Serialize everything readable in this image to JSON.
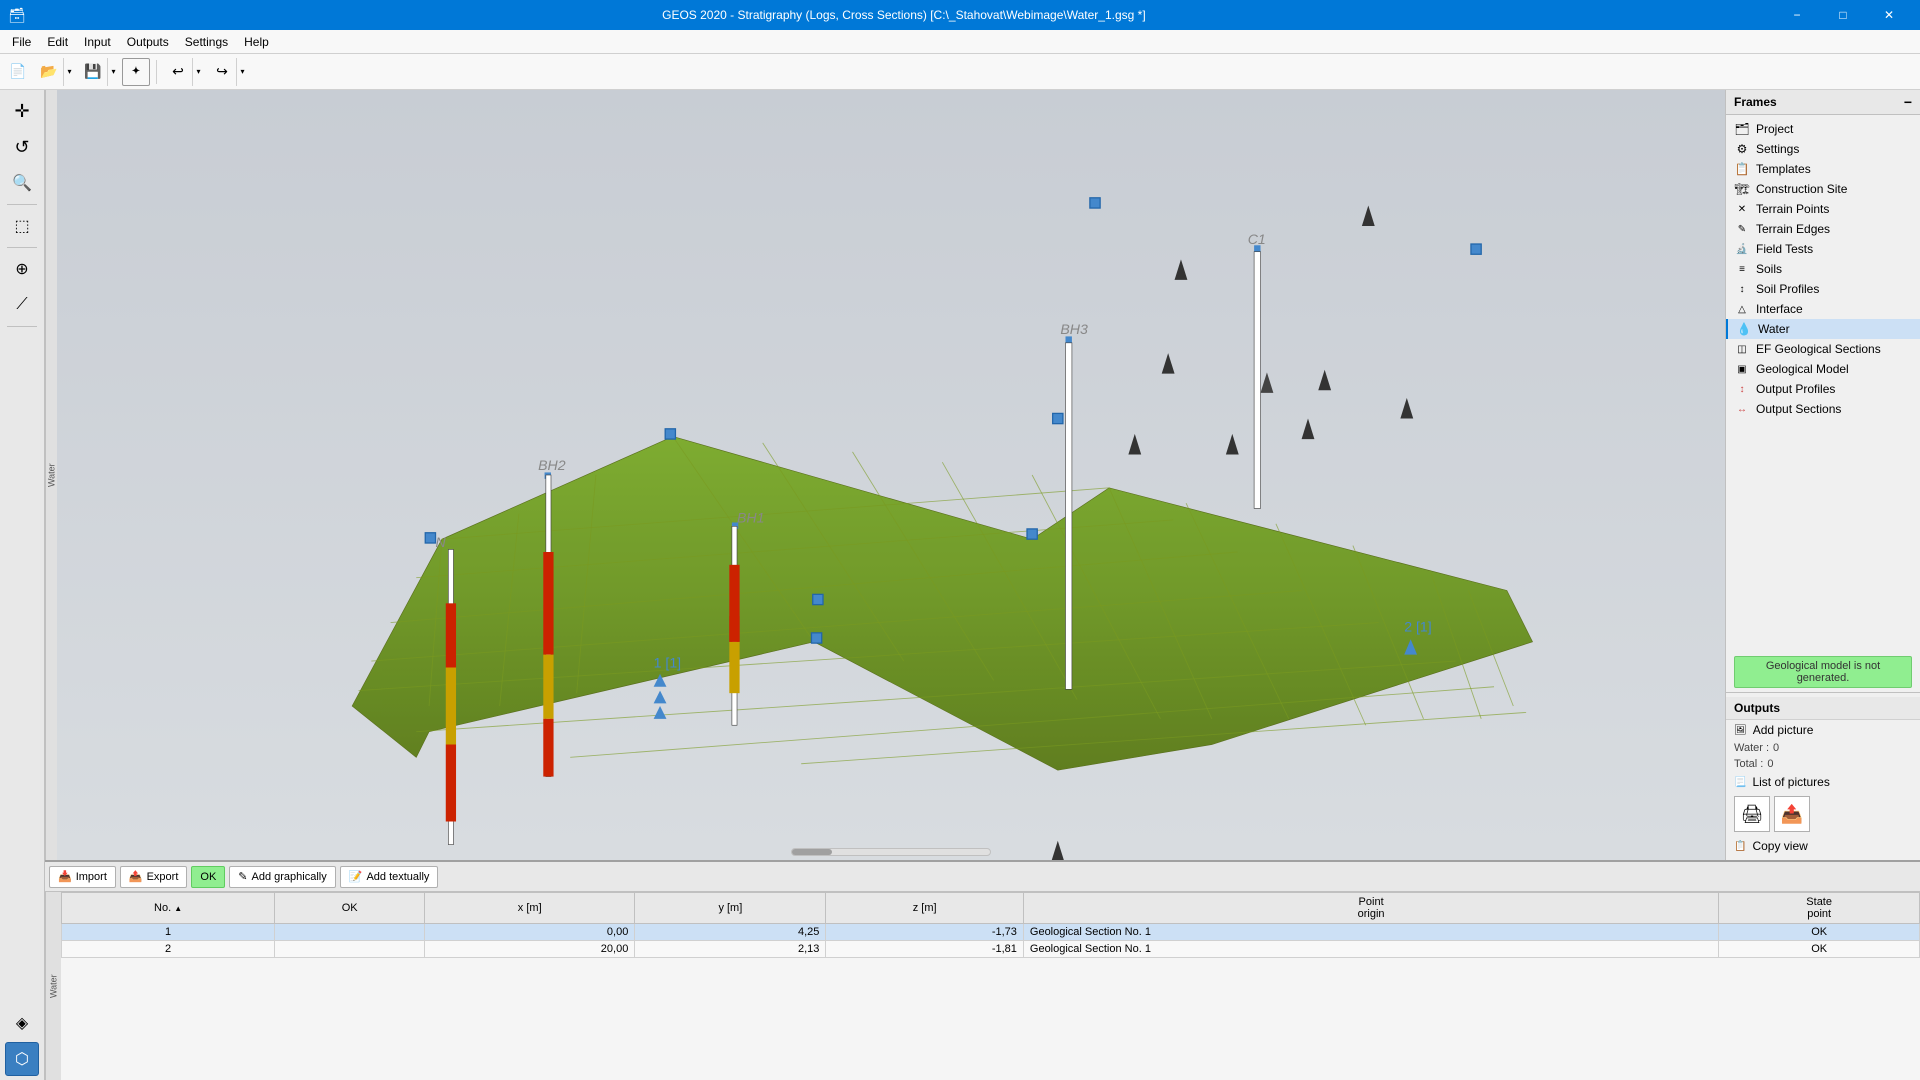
{
  "window": {
    "title": "GEOS 2020 - Stratigraphy (Logs, Cross Sections) [C:\\_Stahovat\\Webimage\\Water_1.gsg *]",
    "icon": "🗃"
  },
  "menu": {
    "items": [
      "File",
      "Edit",
      "Input",
      "Outputs",
      "Settings",
      "Help"
    ]
  },
  "toolbar": {
    "new_label": "📄",
    "open_label": "📂",
    "save_label": "💾",
    "undo_label": "↩",
    "redo_label": "↪"
  },
  "tools": {
    "items": [
      {
        "name": "move",
        "icon": "✛",
        "title": "Move"
      },
      {
        "name": "rotate",
        "icon": "↺",
        "title": "Rotate"
      },
      {
        "name": "zoom",
        "icon": "🔍",
        "title": "Zoom"
      },
      {
        "name": "select-region",
        "icon": "⬚",
        "title": "Select Region"
      },
      {
        "name": "add-point",
        "icon": "⊕",
        "title": "Add Point"
      },
      {
        "name": "add-line",
        "icon": "⟋",
        "title": "Add Line"
      },
      {
        "name": "view-3d",
        "icon": "◈",
        "title": "3D View"
      },
      {
        "name": "view-solid",
        "icon": "⬡",
        "title": "Solid View"
      }
    ]
  },
  "frames": {
    "header": "Frames",
    "items": [
      {
        "id": "project",
        "label": "Project",
        "icon": "🗂"
      },
      {
        "id": "settings",
        "label": "Settings",
        "icon": "⚙"
      },
      {
        "id": "templates",
        "label": "Templates",
        "icon": "📋"
      },
      {
        "id": "construction-site",
        "label": "Construction Site",
        "icon": "🏗"
      },
      {
        "id": "terrain-points",
        "label": "Terrain Points",
        "icon": "✕"
      },
      {
        "id": "terrain-edges",
        "label": "Terrain Edges",
        "icon": "✎"
      },
      {
        "id": "field-tests",
        "label": "Field Tests",
        "icon": "🔬"
      },
      {
        "id": "soils",
        "label": "Soils",
        "icon": "≡"
      },
      {
        "id": "soil-profiles",
        "label": "Soil Profiles",
        "icon": "↕"
      },
      {
        "id": "interface",
        "label": "Interface",
        "icon": "△"
      },
      {
        "id": "water",
        "label": "Water",
        "icon": "💧",
        "active": true
      },
      {
        "id": "geological-sections",
        "label": "Geological Sections",
        "icon": "◫"
      },
      {
        "id": "geological-model",
        "label": "Geological Model",
        "icon": "▣"
      },
      {
        "id": "output-profiles",
        "label": "Output Profiles",
        "icon": "↕"
      },
      {
        "id": "output-sections",
        "label": "Output Sections",
        "icon": "↔"
      }
    ]
  },
  "geo_model_badge": "Geological model is\nnot generated.",
  "outputs": {
    "header": "Outputs",
    "add_picture": "Add picture",
    "water_label": "Water :",
    "water_value": "0",
    "total_label": "Total :",
    "total_value": "0",
    "list_of_pictures": "List of pictures",
    "copy_view": "Copy view"
  },
  "bottom_toolbar": {
    "import": "Import",
    "export": "Export",
    "ok_label": "OK",
    "add_graphically": "Add graphically",
    "add_textually": "Add textually"
  },
  "table": {
    "columns": [
      {
        "id": "no",
        "label": "No.",
        "sort": "asc"
      },
      {
        "id": "ok",
        "label": "OK"
      },
      {
        "id": "x",
        "label": "x [m]"
      },
      {
        "id": "y",
        "label": "y [m]"
      },
      {
        "id": "z",
        "label": "z [m]"
      },
      {
        "id": "point_origin",
        "label": "Point\norigin"
      },
      {
        "id": "state_point",
        "label": "State\npoint"
      }
    ],
    "rows": [
      {
        "no": "1",
        "ok": "",
        "x": "0,00",
        "y": "4,25",
        "z": "-1,73",
        "point_origin": "Geological Section No. 1",
        "state_point": "OK"
      },
      {
        "no": "2",
        "ok": "",
        "x": "20,00",
        "y": "2,13",
        "z": "-1,81",
        "point_origin": "Geological Section No. 1",
        "state_point": "OK"
      }
    ]
  },
  "left_label": "Water",
  "bottom_left_label": "Water",
  "viewport": {
    "borehole_labels": [
      "BH1",
      "BH2",
      "BH3",
      "C1",
      "N"
    ],
    "section_labels": [
      "1 [1]",
      "2 [1]"
    ]
  },
  "colors": {
    "accent": "#0078d7",
    "active_item": "#cce0f5",
    "terrain_surface": "#6b8e23",
    "borehole_red": "#cc2200",
    "borehole_yellow": "#c8a000",
    "water_blue": "#4488cc",
    "title_bar": "#0078d7"
  }
}
